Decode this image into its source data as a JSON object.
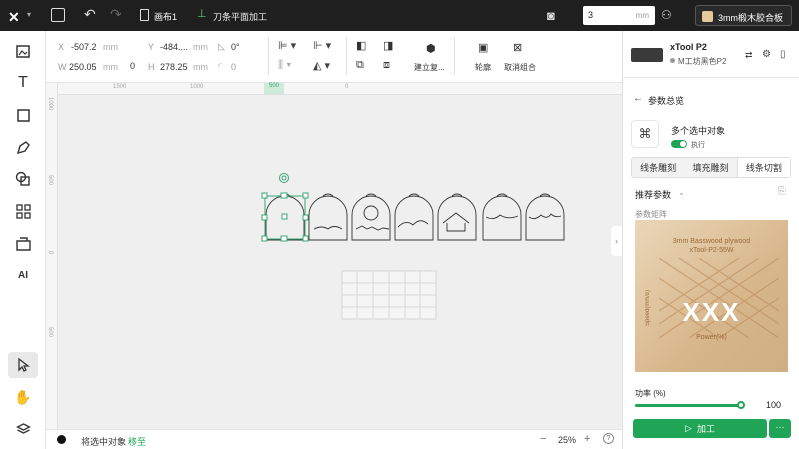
{
  "topbar": {
    "canvas_name": "画布1",
    "mode_label": "刀条平面加工",
    "focus_value": "3",
    "focus_unit": "mm",
    "material": "3mm椴木胶合板"
  },
  "lefttools": [
    "add-image-icon",
    "text-icon",
    "shape-icon",
    "pen-icon",
    "combine-icon",
    "apps-icon",
    "material-icon",
    "ai-icon",
    "select-icon",
    "hand-icon",
    "layers-icon"
  ],
  "props": {
    "x_label": "X",
    "x_value": "-507.2",
    "x_unit": "mm",
    "y_label": "Y",
    "y_value": "-484....",
    "y_unit": "mm",
    "w_label": "W",
    "w_value": "250.05",
    "w_unit": "mm",
    "h_label": "H",
    "h_value": "278.25",
    "h_unit": "mm",
    "rotate": "0°",
    "corner": "0",
    "group_label": "建立复...",
    "outline_label": "轮廓",
    "ungroup_label": "取消组合"
  },
  "ruler": {
    "ticks": [
      "1500",
      "1000",
      "500",
      "0"
    ],
    "highlight": "500",
    "left_ticks": [
      "1000",
      "500",
      "0",
      "500"
    ]
  },
  "status": {
    "text": "将选中对象",
    "link": "移至",
    "zoom": "25%",
    "minus": "−",
    "plus": "+"
  },
  "device": {
    "name": "xTool P2",
    "sub": "M工坊黑色P2"
  },
  "panel": {
    "back_label": "参数总览",
    "multi_title": "多个选中对象",
    "toggle_label": "执行",
    "tabs": [
      "线条雕刻",
      "填充雕刻",
      "线条切割"
    ],
    "active_tab": 2,
    "recommend": "推荐参数",
    "matrix_label": "参数矩阵",
    "photo_line1": "3mm Basswood plywood",
    "photo_line2": "xTool-P2-55W",
    "photo_ylabel": "Speed(mm/s)",
    "photo_xlabel": "Power(%)",
    "photo_marks": "XXX",
    "power_label": "功率 (%)",
    "power_value": "100",
    "process_label": "加工",
    "more": "···"
  },
  "colors": {
    "accent": "#1fa555",
    "dark": "#1f1f1f",
    "selection": "#3aa776"
  }
}
